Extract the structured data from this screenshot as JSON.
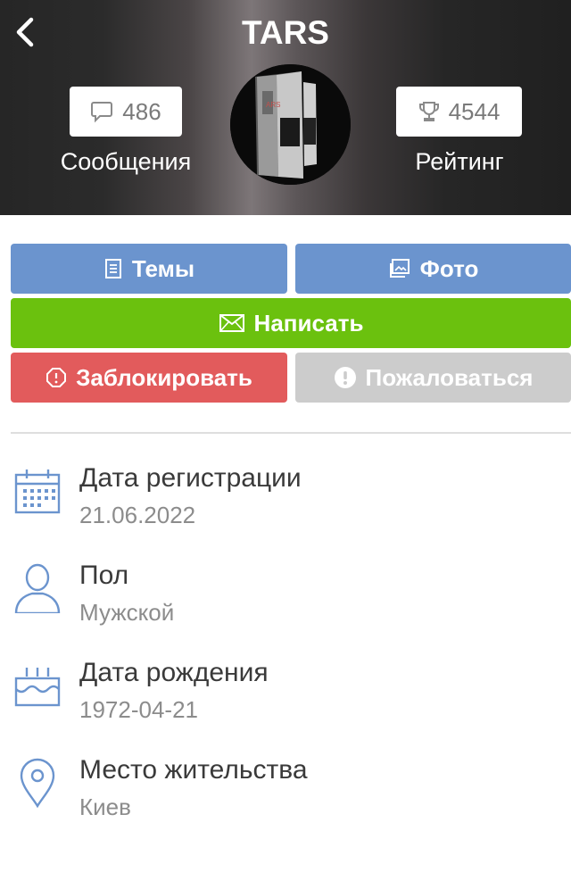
{
  "header": {
    "title": "TARS",
    "back_icon": "chevron-left-icon",
    "messages": {
      "count": "486",
      "label": "Сообщения",
      "icon": "chat-bubble-icon"
    },
    "rating": {
      "count": "4544",
      "label": "Рейтинг",
      "icon": "trophy-icon"
    },
    "avatar": {
      "icon": "avatar-image"
    }
  },
  "actions": {
    "topics": {
      "label": "Темы",
      "icon": "document-list-icon",
      "color": "#6b94ce"
    },
    "photo": {
      "label": "Фото",
      "icon": "image-icon",
      "color": "#6b94ce"
    },
    "write": {
      "label": "Написать",
      "icon": "envelope-icon",
      "color": "#6bc10e"
    },
    "block": {
      "label": "Заблокировать",
      "icon": "block-octagon-icon",
      "color": "#e25b5c"
    },
    "report": {
      "label": "Пожаловаться",
      "icon": "exclamation-circle-icon",
      "color": "#cccccc"
    }
  },
  "info": [
    {
      "title": "Дата регистрации",
      "value": "21.06.2022",
      "icon": "calendar-icon"
    },
    {
      "title": "Пол",
      "value": "Мужской",
      "icon": "user-icon"
    },
    {
      "title": "Дата рождения",
      "value": "1972-04-21",
      "icon": "birthday-cake-icon"
    },
    {
      "title": "Место жительства",
      "value": "Киев",
      "icon": "location-pin-icon"
    }
  ],
  "colors": {
    "icon_blue": "#6b94ce",
    "header_bg": "#262626"
  }
}
